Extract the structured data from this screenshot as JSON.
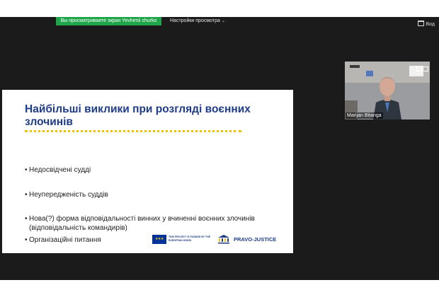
{
  "toolbar": {
    "share_banner": "Вы просматриваете экран Yevhenii zhurko",
    "view_options_label": "Настройки просмотра",
    "view_button_label": "Вид"
  },
  "slide": {
    "title": "Найбільші виклики при розгляді воєнних злочинів",
    "bullets": [
      "Недосвідчені судді",
      "Неупередженість суддів",
      "Нова(?) форма відповідальності винних у вчиненні воєнних злочинів (відповідальність командирів)",
      "Організаційні питання"
    ],
    "footer": {
      "eu_text": "THIS PROJECT IS FUNDED BY THE EUROPEAN UNION",
      "logo_text": "PRAVO-JUSTICE"
    }
  },
  "participant": {
    "name": "Marijan Bitanga"
  },
  "colors": {
    "banner": "#1fa64a",
    "meeting_bg": "#1b1b1b",
    "title": "#1f3c88",
    "underline": "#f2c200"
  },
  "icons": [
    "chevron-down-icon",
    "window-icon",
    "eu-flag-icon",
    "pravo-justice-logo-icon"
  ]
}
